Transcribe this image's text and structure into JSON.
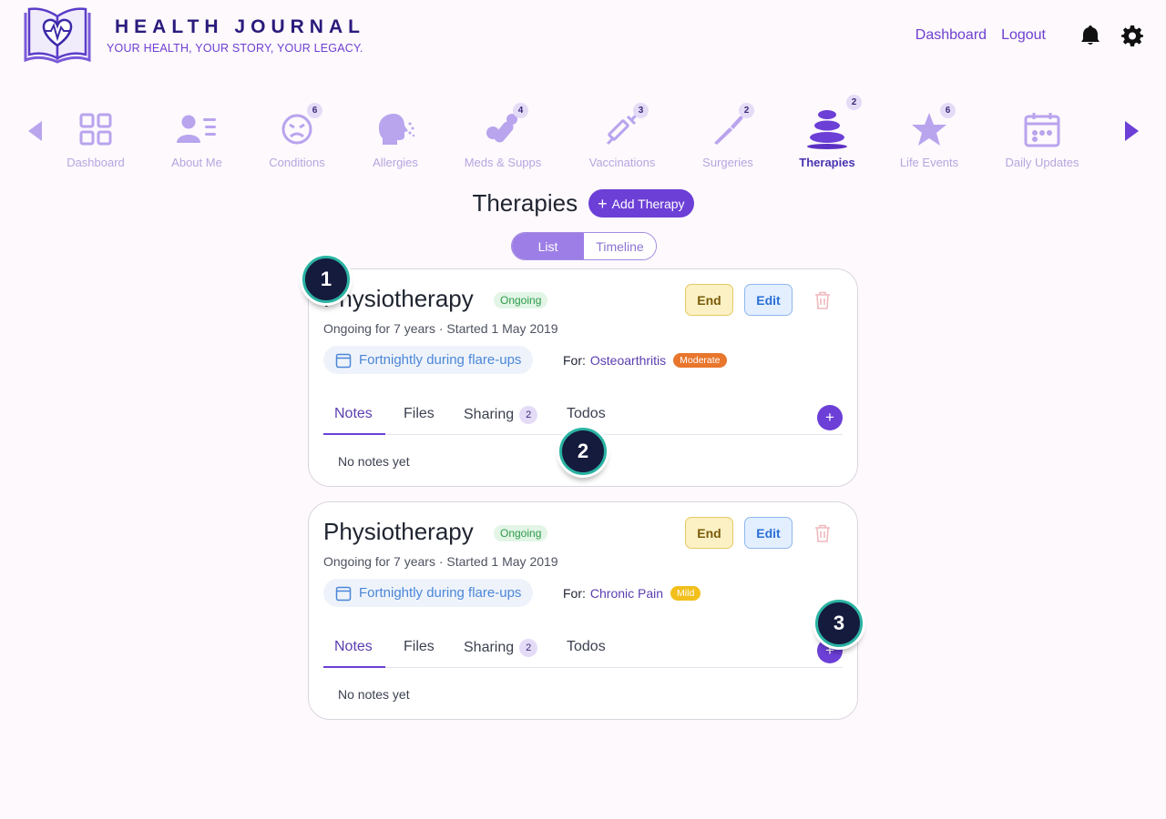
{
  "brand": {
    "title": "HEALTH JOURNAL",
    "tagline": "YOUR HEALTH, YOUR STORY, YOUR LEGACY."
  },
  "top_nav": {
    "dashboard": "Dashboard",
    "logout": "Logout",
    "icons": [
      "bell-icon",
      "gear-icon"
    ]
  },
  "categories": [
    {
      "label": "Dashboard",
      "icon": "grid-icon",
      "badge": ""
    },
    {
      "label": "About Me",
      "icon": "person-card-icon",
      "badge": ""
    },
    {
      "label": "Conditions",
      "icon": "sick-face-icon",
      "badge": "6"
    },
    {
      "label": "Allergies",
      "icon": "sneeze-icon",
      "badge": ""
    },
    {
      "label": "Meds & Supps",
      "icon": "pills-icon",
      "badge": "4"
    },
    {
      "label": "Vaccinations",
      "icon": "syringe-icon",
      "badge": "3"
    },
    {
      "label": "Surgeries",
      "icon": "scalpel-icon",
      "badge": "2"
    },
    {
      "label": "Therapies",
      "icon": "stones-icon",
      "badge": "2",
      "active": true
    },
    {
      "label": "Life Events",
      "icon": "star-icon",
      "badge": "6"
    },
    {
      "label": "Daily Updates",
      "icon": "calendar-icon",
      "badge": ""
    }
  ],
  "page": {
    "title": "Therapies",
    "add_button": "Add Therapy",
    "view_list": "List",
    "view_timeline": "Timeline"
  },
  "therapies": [
    {
      "name": "Physiotherapy",
      "status": "Ongoing",
      "end_label": "End",
      "edit_label": "Edit",
      "meta": "Ongoing for 7 years · Started 1 May 2019",
      "frequency": "Fortnightly during flare-ups",
      "for_label": "For:",
      "condition": "Osteoarthritis",
      "severity": "Moderate",
      "tabs": {
        "notes": "Notes",
        "files": "Files",
        "sharing": "Sharing",
        "sharing_count": "2",
        "todos": "Todos"
      },
      "empty": "No notes yet"
    },
    {
      "name": "Physiotherapy",
      "status": "Ongoing",
      "end_label": "End",
      "edit_label": "Edit",
      "meta": "Ongoing for 7 years · Started 1 May 2019",
      "frequency": "Fortnightly during flare-ups",
      "for_label": "For:",
      "condition": "Chronic Pain",
      "severity": "Mild",
      "tabs": {
        "notes": "Notes",
        "files": "Files",
        "sharing": "Sharing",
        "sharing_count": "2",
        "todos": "Todos"
      },
      "empty": "No notes yet"
    }
  ],
  "markers": [
    "1",
    "2",
    "3"
  ],
  "colors": {
    "accent": "#6c3fd6",
    "brand_dark": "#2a1b7c",
    "marker_fill": "#151b3d",
    "marker_ring": "#2bb3a3"
  }
}
